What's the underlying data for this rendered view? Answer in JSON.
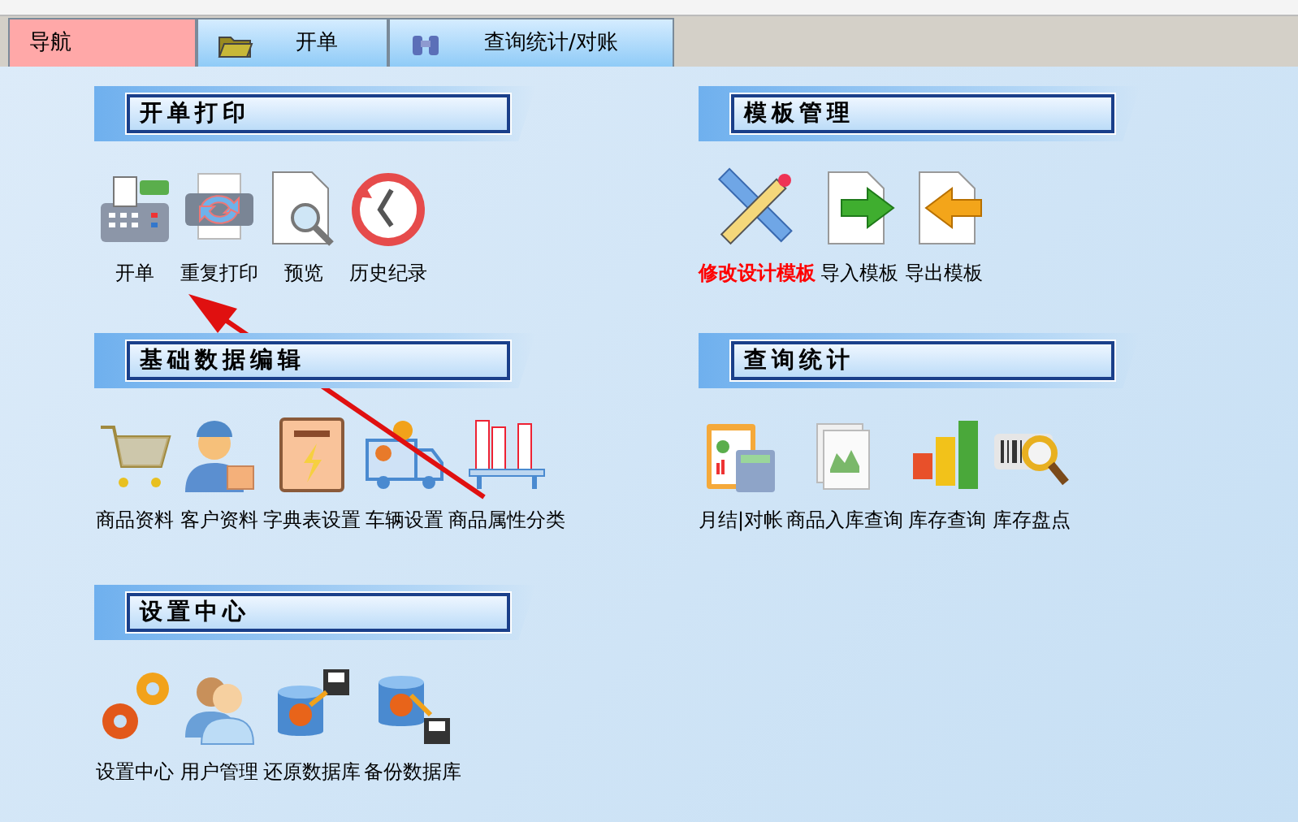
{
  "tabs": [
    {
      "label": "导航",
      "selected": true
    },
    {
      "label": "开单",
      "selected": false
    },
    {
      "label": "查询统计/对账",
      "selected": false
    }
  ],
  "sections": [
    {
      "title": "开单打印",
      "items": [
        {
          "label": "开单",
          "emphasized": false
        },
        {
          "label": "重复打印",
          "emphasized": false
        },
        {
          "label": "预览",
          "emphasized": false
        },
        {
          "label": "历史纪录",
          "emphasized": false
        }
      ]
    },
    {
      "title": "模板管理",
      "items": [
        {
          "label": "修改设计模板",
          "emphasized": true
        },
        {
          "label": "导入模板",
          "emphasized": false
        },
        {
          "label": "导出模板",
          "emphasized": false
        }
      ]
    },
    {
      "title": "基础数据编辑",
      "items": [
        {
          "label": "商品资料",
          "emphasized": false
        },
        {
          "label": "客户资料",
          "emphasized": false
        },
        {
          "label": "字典表设置",
          "emphasized": false
        },
        {
          "label": "车辆设置",
          "emphasized": false
        },
        {
          "label": "商品属性分类",
          "emphasized": false
        }
      ]
    },
    {
      "title": "查询统计",
      "items": [
        {
          "label": "月结|对帐",
          "emphasized": false
        },
        {
          "label": "商品入库查询",
          "emphasized": false
        },
        {
          "label": "库存查询",
          "emphasized": false
        },
        {
          "label": "库存盘点",
          "emphasized": false
        }
      ]
    },
    {
      "title": "设置中心",
      "items": [
        {
          "label": "设置中心",
          "emphasized": false
        },
        {
          "label": "用户管理",
          "emphasized": false
        },
        {
          "label": "还原数据库",
          "emphasized": false
        },
        {
          "label": "备份数据库",
          "emphasized": false
        }
      ]
    }
  ]
}
